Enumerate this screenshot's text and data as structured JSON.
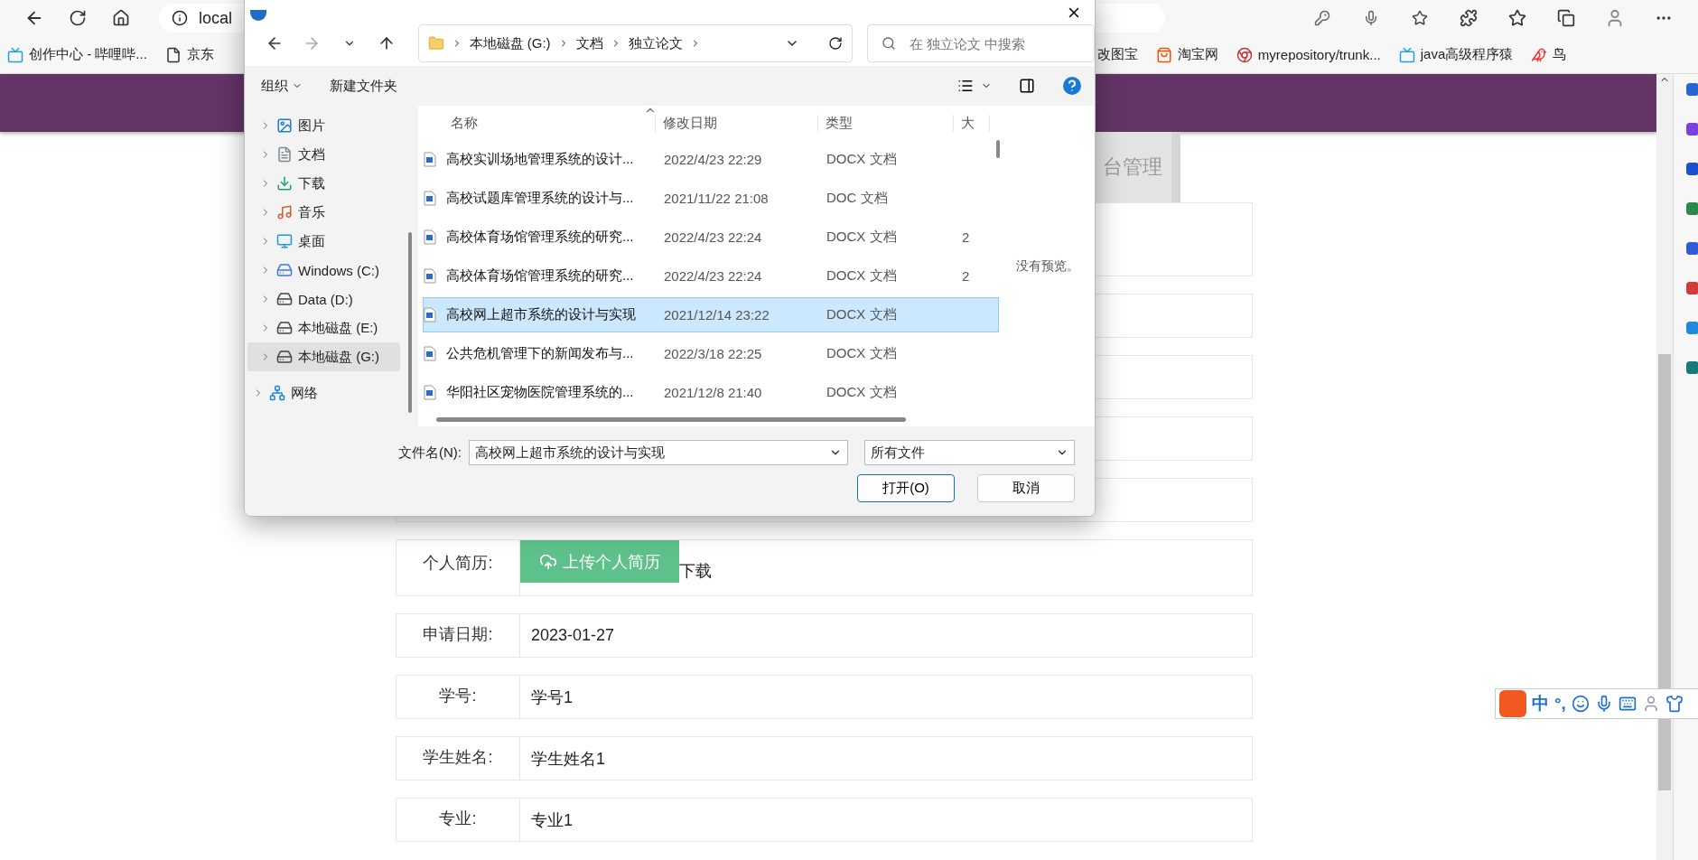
{
  "browser": {
    "address": "local",
    "bookmarks_left": [
      {
        "kind": "bilibili",
        "label": "创作中心 - 哔哩哔..."
      },
      {
        "kind": "page",
        "label": "京东"
      }
    ],
    "bookmarks_right": [
      {
        "kind": "plain",
        "label": "改图宝"
      },
      {
        "kind": "taobao",
        "label": "淘宝网"
      },
      {
        "kind": "chrome",
        "label": "myrepository/trunk..."
      },
      {
        "kind": "bilibili",
        "label": "java高级程序猿"
      },
      {
        "kind": "bird",
        "label": "鸟"
      }
    ]
  },
  "page": {
    "tab": {
      "label": "台管理"
    },
    "rows": [
      {
        "kind": "upload",
        "label": "个人简历:",
        "button": "上传个人简历",
        "link": "下载"
      },
      {
        "kind": "text",
        "label": "申请日期:",
        "value": "2023-01-27"
      },
      {
        "kind": "text",
        "label": "学号:",
        "value": "学号1"
      },
      {
        "kind": "text",
        "label": "学生姓名:",
        "value": "学生姓名1"
      },
      {
        "kind": "text",
        "label": "专业:",
        "value": "专业1"
      }
    ]
  },
  "dialog": {
    "path": [
      "本地磁盘 (G:)",
      "文档",
      "独立论文"
    ],
    "search": {
      "placeholder": "在 独立论文 中搜索"
    },
    "commands": [
      "组织",
      "新建文件夹"
    ],
    "nav": [
      {
        "kind": "pictures",
        "label": "图片",
        "selected": false
      },
      {
        "kind": "documents",
        "label": "文档",
        "selected": false
      },
      {
        "kind": "downloads",
        "label": "下载",
        "selected": false
      },
      {
        "kind": "music",
        "label": "音乐",
        "selected": false
      },
      {
        "kind": "desktop",
        "label": "桌面",
        "selected": false
      },
      {
        "kind": "system-drive",
        "label": "Windows (C:)",
        "selected": false
      },
      {
        "kind": "drive",
        "label": "Data (D:)",
        "selected": false
      },
      {
        "kind": "drive",
        "label": "本地磁盘 (E:)",
        "selected": false
      },
      {
        "kind": "drive",
        "label": "本地磁盘 (G:)",
        "selected": true
      }
    ],
    "network": {
      "label": "网络"
    },
    "columns": [
      "名称",
      "修改日期",
      "类型",
      "大"
    ],
    "files": [
      {
        "name": "高校实训场地管理系统的设计...",
        "date": "2022/4/23 22:29",
        "type": "DOCX 文档",
        "selected": false
      },
      {
        "name": "高校试题库管理系统的设计与...",
        "date": "2021/11/22 21:08",
        "type": "DOC 文档",
        "selected": false
      },
      {
        "name": "高校体育场馆管理系统的研究...",
        "date": "2022/4/23 22:24",
        "type": "DOCX 文档",
        "size": "2",
        "selected": false
      },
      {
        "name": "高校体育场馆管理系统的研究...",
        "date": "2022/4/23 22:24",
        "type": "DOCX 文档",
        "size": "2",
        "selected": false
      },
      {
        "name": "高校网上超市系统的设计与实现",
        "date": "2021/12/14 23:22",
        "type": "DOCX 文档",
        "selected": true
      },
      {
        "name": "公共危机管理下的新闻发布与...",
        "date": "2022/3/18 22:25",
        "type": "DOCX 文档",
        "selected": false
      },
      {
        "name": "华阳社区宠物医院管理系统的...",
        "date": "2021/12/8 21:40",
        "type": "DOCX 文档",
        "selected": false
      }
    ],
    "preview": "没有预览。",
    "filename_label": "文件名(N):",
    "filename": "高校网上超市系统的设计与实现",
    "filetype": "所有文件",
    "buttons": [
      "打开(O)",
      "取消"
    ]
  },
  "ime": {
    "mode": "中",
    "punctuation": "°,"
  }
}
